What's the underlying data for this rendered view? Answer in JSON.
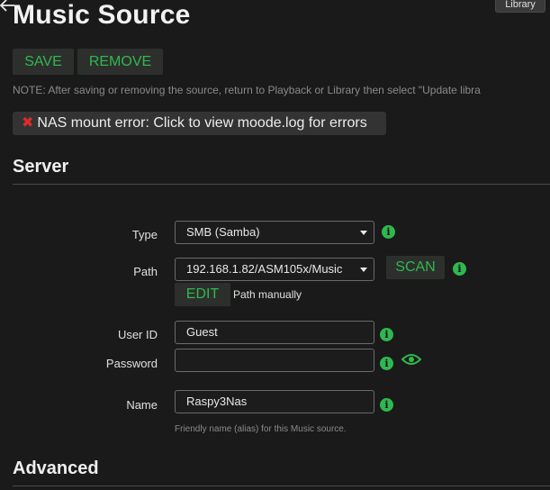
{
  "header": {
    "back_glyph": "🡐",
    "library_label": "Library",
    "title": "Music Source"
  },
  "actions": {
    "save_label": "SAVE",
    "remove_label": "REMOVE"
  },
  "note": "NOTE: After saving or removing the source, return to Playback or Library then select \"Update libra",
  "error": {
    "icon": "✖",
    "text": "NAS mount error: Click to view moode.log for errors"
  },
  "server": {
    "heading": "Server",
    "type_label": "Type",
    "type_value": "SMB (Samba)",
    "path_label": "Path",
    "path_value": "192.168.1.82/ASM105x/Music",
    "scan_label": "SCAN",
    "edit_label": "EDIT",
    "edit_note": "Path manually",
    "userid_label": "User ID",
    "userid_value": "Guest",
    "password_label": "Password",
    "password_value": "",
    "name_label": "Name",
    "name_value": "Raspy3Nas",
    "name_helper": "Friendly name (alias) for this Music source."
  },
  "advanced": {
    "heading": "Advanced"
  },
  "icons": {
    "info_glyph": "i"
  },
  "colors": {
    "accent_green": "#2fb84f",
    "error_red": "#e02a2a",
    "background": "#1a1a1a"
  }
}
